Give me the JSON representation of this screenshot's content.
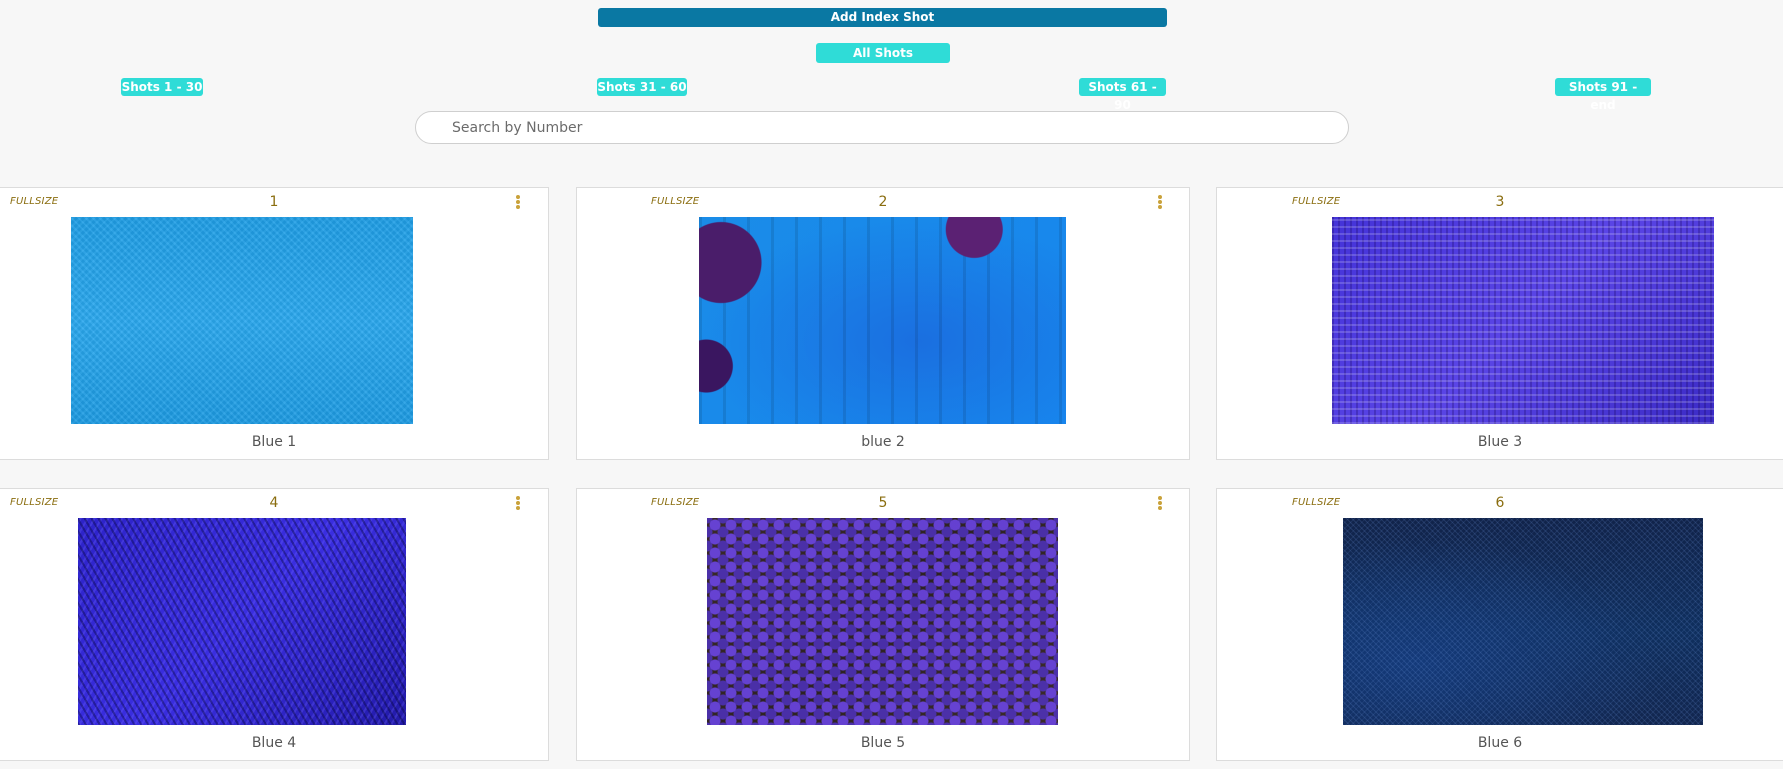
{
  "header": {
    "add_index_label": "Add Index Shot",
    "all_shots_label": "All Shots",
    "ranges": [
      "Shots 1 - 30",
      "Shots 31 - 60",
      "Shots 61 - 90",
      "Shots 91 - end"
    ]
  },
  "search": {
    "placeholder": "Search by Number",
    "value": ""
  },
  "cards": [
    {
      "badge": "FULLSIZE",
      "number": "1",
      "caption": "Blue 1"
    },
    {
      "badge": "FULLSIZE",
      "number": "2",
      "caption": "blue 2"
    },
    {
      "badge": "FULLSIZE",
      "number": "3",
      "caption": "Blue 3"
    },
    {
      "badge": "FULLSIZE",
      "number": "4",
      "caption": "Blue 4"
    },
    {
      "badge": "FULLSIZE",
      "number": "5",
      "caption": "Blue 5"
    },
    {
      "badge": "FULLSIZE",
      "number": "6",
      "caption": "Blue 6"
    }
  ],
  "colors": {
    "primary_button": "#0a78a3",
    "accent_button": "#2fdcd7",
    "badge_text": "#8a6d0f"
  },
  "icons": {
    "card_menu": "kebab-menu-icon"
  }
}
